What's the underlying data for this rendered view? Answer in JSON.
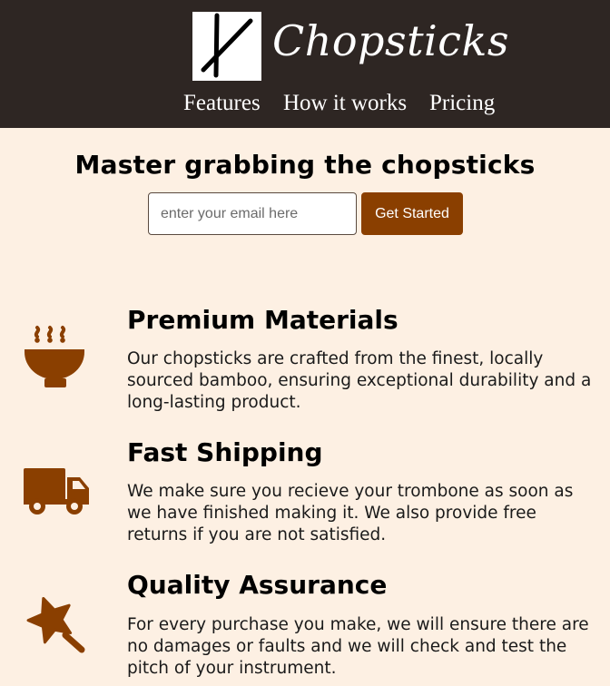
{
  "header": {
    "brand": "Chopsticks",
    "logo_icon": "chopsticks-logo-icon",
    "nav": [
      {
        "label": "Features"
      },
      {
        "label": "How it works"
      },
      {
        "label": "Pricing"
      }
    ]
  },
  "hero": {
    "title": "Master grabbing the chopsticks",
    "email_placeholder": "enter your email here",
    "email_value": "",
    "cta_label": "Get Started"
  },
  "features": [
    {
      "icon": "bowl-icon",
      "title": "Premium Materials",
      "text": "Our chopsticks are crafted from the finest, locally sourced bamboo, ensuring exceptional durability and a long-lasting product."
    },
    {
      "icon": "truck-icon",
      "title": "Fast Shipping",
      "text": "We make sure you recieve your trombone as soon as we have finished making it. We also provide free returns if you are not satisfied."
    },
    {
      "icon": "magic-wand-star-icon",
      "title": "Quality Assurance",
      "text": "For every purchase you make, we will ensure there are no damages or faults and we will check and test the pitch of your instrument."
    }
  ],
  "colors": {
    "header_bg": "#2e2623",
    "page_bg": "#fdf0e3",
    "accent": "#8a3f00"
  }
}
